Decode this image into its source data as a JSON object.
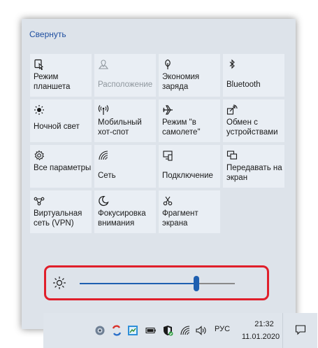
{
  "collapse_label": "Свернуть",
  "tiles": [
    {
      "icon": "tablet-mode-icon",
      "label": "Режим планшета",
      "disabled": false
    },
    {
      "icon": "location-icon",
      "label": "Расположение",
      "disabled": true
    },
    {
      "icon": "battery-saver-icon",
      "label": "Экономия заряда",
      "disabled": false
    },
    {
      "icon": "bluetooth-icon",
      "label": "Bluetooth",
      "disabled": false
    },
    {
      "icon": "night-light-icon",
      "label": "Ночной свет",
      "disabled": false
    },
    {
      "icon": "mobile-hotspot-icon",
      "label": "Мобильный хот-спот",
      "disabled": false
    },
    {
      "icon": "airplane-icon",
      "label": "Режим \"в самолете\"",
      "disabled": false
    },
    {
      "icon": "nearby-sharing-icon",
      "label": "Обмен с устройствами",
      "disabled": false
    },
    {
      "icon": "settings-gear-icon",
      "label": "Все параметры",
      "disabled": false
    },
    {
      "icon": "network-icon",
      "label": "Сеть",
      "disabled": false
    },
    {
      "icon": "connect-icon",
      "label": "Подключение",
      "disabled": false
    },
    {
      "icon": "project-icon",
      "label": "Передавать на экран",
      "disabled": false
    },
    {
      "icon": "vpn-icon",
      "label": "Виртуальная сеть (VPN)",
      "disabled": false
    },
    {
      "icon": "focus-assist-icon",
      "label": "Фокусировка внимания",
      "disabled": false
    },
    {
      "icon": "screen-snip-icon",
      "label": "Фрагмент экрана",
      "disabled": false
    }
  ],
  "brightness": {
    "value": 0.75,
    "accent": "#1e5fb0",
    "highlight_border": "#e01f2b"
  },
  "taskbar": {
    "language": "РУС",
    "time": "21:32",
    "date": "11.01.2020"
  }
}
